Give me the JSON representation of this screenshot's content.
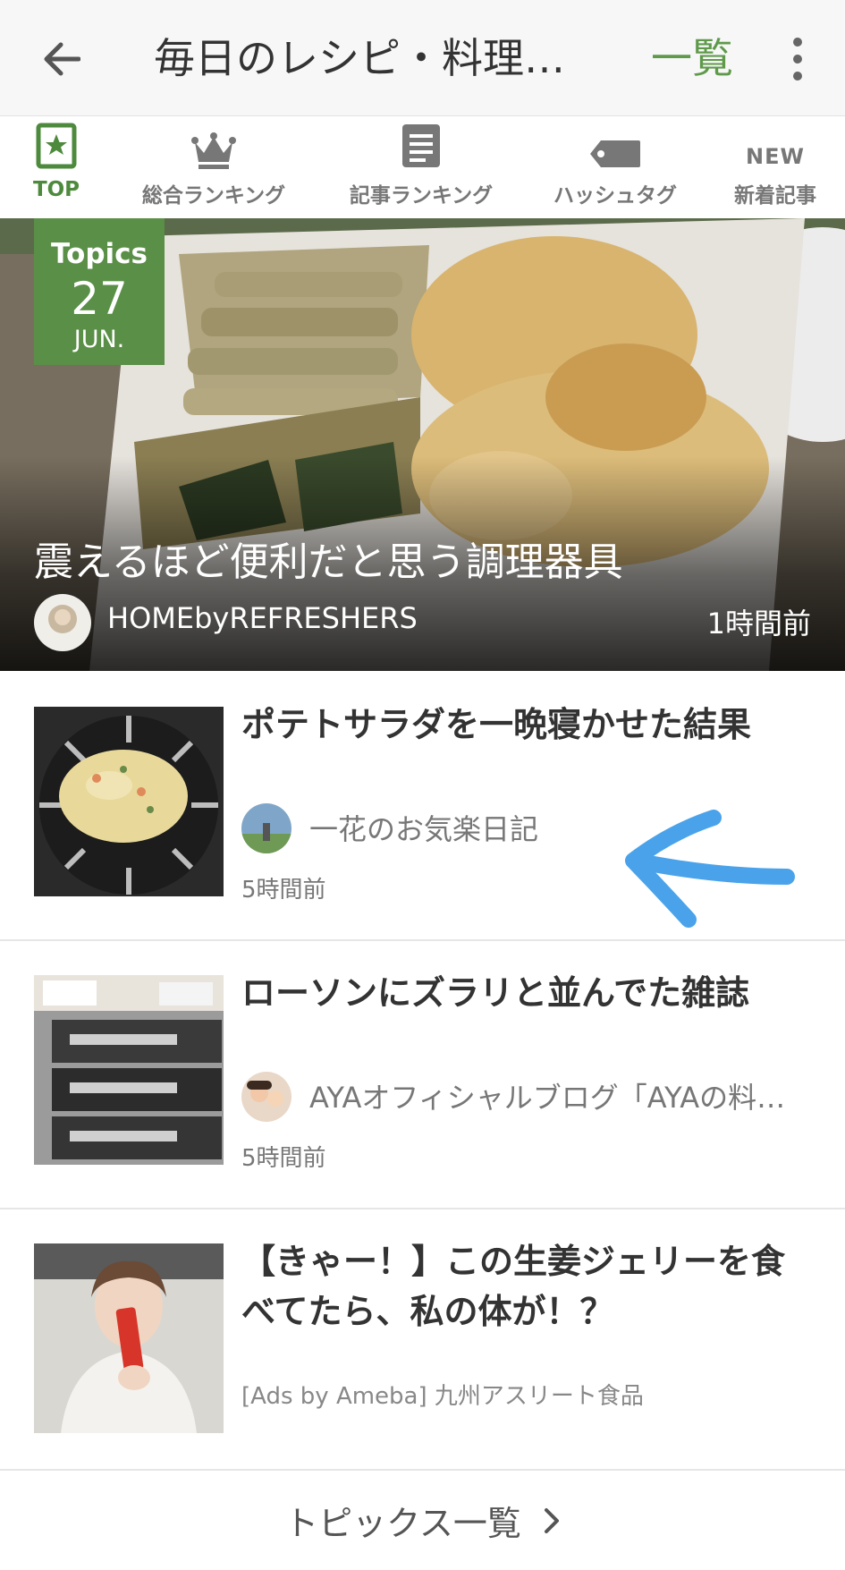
{
  "header": {
    "title": "毎日のレシピ・料理…",
    "list_link": "一覧"
  },
  "tabs": [
    {
      "label": "TOP",
      "icon": "star-icon",
      "active": true
    },
    {
      "label": "総合ランキング",
      "icon": "crown-icon"
    },
    {
      "label": "記事ランキング",
      "icon": "document-icon"
    },
    {
      "label": "ハッシュタグ",
      "icon": "tag-icon"
    },
    {
      "label": "新着記事",
      "icon": "new-icon",
      "icon_text": "NEW"
    }
  ],
  "hero": {
    "badge_label": "Topics",
    "badge_day": "27",
    "badge_month": "JUN.",
    "title": "震えるほど便利だと思う調理器具",
    "author": "HOMEbyREFRESHERS",
    "time": "1時間前"
  },
  "articles": [
    {
      "title": "ポテトサラダを一晩寝かせた結果",
      "author": "一花のお気楽日記",
      "time": "5時間前"
    },
    {
      "title": "ローソンにズラリと並んでた雑誌",
      "author": "AYAオフィシャルブログ「AYAの料…",
      "time": "5時間前"
    },
    {
      "title": "【きゃー！】この生姜ジェリーを食べてたら、私の体が！？",
      "ad": "[Ads by Ameba] 九州アスリート食品"
    }
  ],
  "footer": {
    "label": "トピックス一覧"
  },
  "colors": {
    "accent_green": "#5f9a4b",
    "badge_green": "#5a8f47",
    "annotation_arrow": "#4aa3ea"
  }
}
